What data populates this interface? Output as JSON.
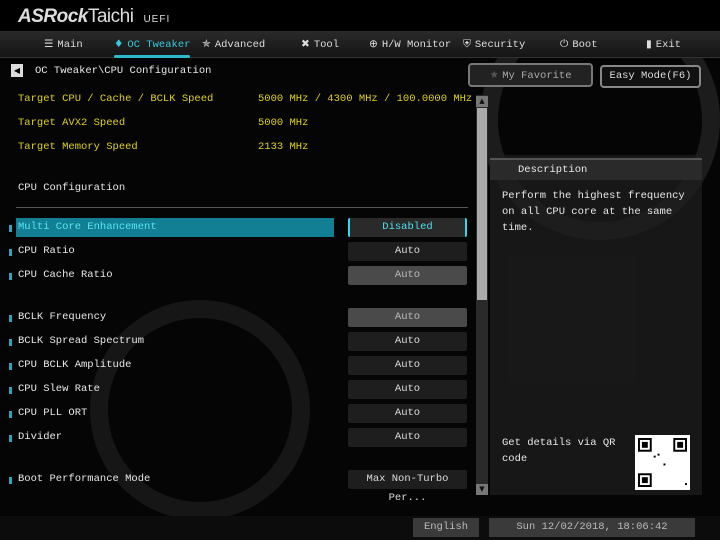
{
  "brand": {
    "name": "ASRock",
    "model": "Taichi",
    "suffix": "UEFI"
  },
  "nav": [
    {
      "label": "Main",
      "icon": "list-icon",
      "glyph": "☰"
    },
    {
      "label": "OC Tweaker",
      "icon": "flame-icon",
      "glyph": "♦",
      "active": true
    },
    {
      "label": "Advanced",
      "icon": "star-wrench-icon",
      "glyph": "✯"
    },
    {
      "label": "Tool",
      "icon": "tools-icon",
      "glyph": "✖"
    },
    {
      "label": "H/W Monitor",
      "icon": "monitor-target-icon",
      "glyph": "⊕"
    },
    {
      "label": "Security",
      "icon": "shield-icon",
      "glyph": "⛨"
    },
    {
      "label": "Boot",
      "icon": "power-icon",
      "glyph": "⏻"
    },
    {
      "label": "Exit",
      "icon": "door-icon",
      "glyph": "▮"
    }
  ],
  "breadcrumb": "OC Tweaker\\CPU Configuration",
  "favorite_label": "My Favorite",
  "easy_mode_label": "Easy Mode(F6)",
  "targets": [
    {
      "label": "Target CPU / Cache / BCLK Speed",
      "value": "5000 MHz / 4300 MHz / 100.0000 MHz"
    },
    {
      "label": "Target AVX2 Speed",
      "value": "5000 MHz"
    },
    {
      "label": "Target Memory Speed",
      "value": "2133 MHz"
    }
  ],
  "section_title": "CPU Configuration",
  "settings": [
    {
      "label": "Multi Core Enhancement",
      "value": "Disabled",
      "selected": true
    },
    {
      "label": "CPU Ratio",
      "value": "Auto"
    },
    {
      "label": "CPU Cache Ratio",
      "value": "Auto",
      "grey": true
    },
    {
      "label": "BCLK Frequency",
      "value": "Auto",
      "grey": true
    },
    {
      "label": "BCLK Spread Spectrum",
      "value": "Auto"
    },
    {
      "label": "CPU BCLK Amplitude",
      "value": "Auto"
    },
    {
      "label": "CPU Slew Rate",
      "value": "Auto"
    },
    {
      "label": "CPU PLL ORT",
      "value": "Auto"
    },
    {
      "label": "Divider",
      "value": "Auto"
    },
    {
      "label": "Boot Performance Mode",
      "value": "Max Non-Turbo Per..."
    }
  ],
  "description": {
    "title": "Description",
    "text": "Perform the highest frequency on all CPU core at the same time.",
    "qr_text": "Get details via QR code"
  },
  "footer": {
    "language": "English",
    "datetime": "Sun 12/02/2018, 18:06:42"
  }
}
